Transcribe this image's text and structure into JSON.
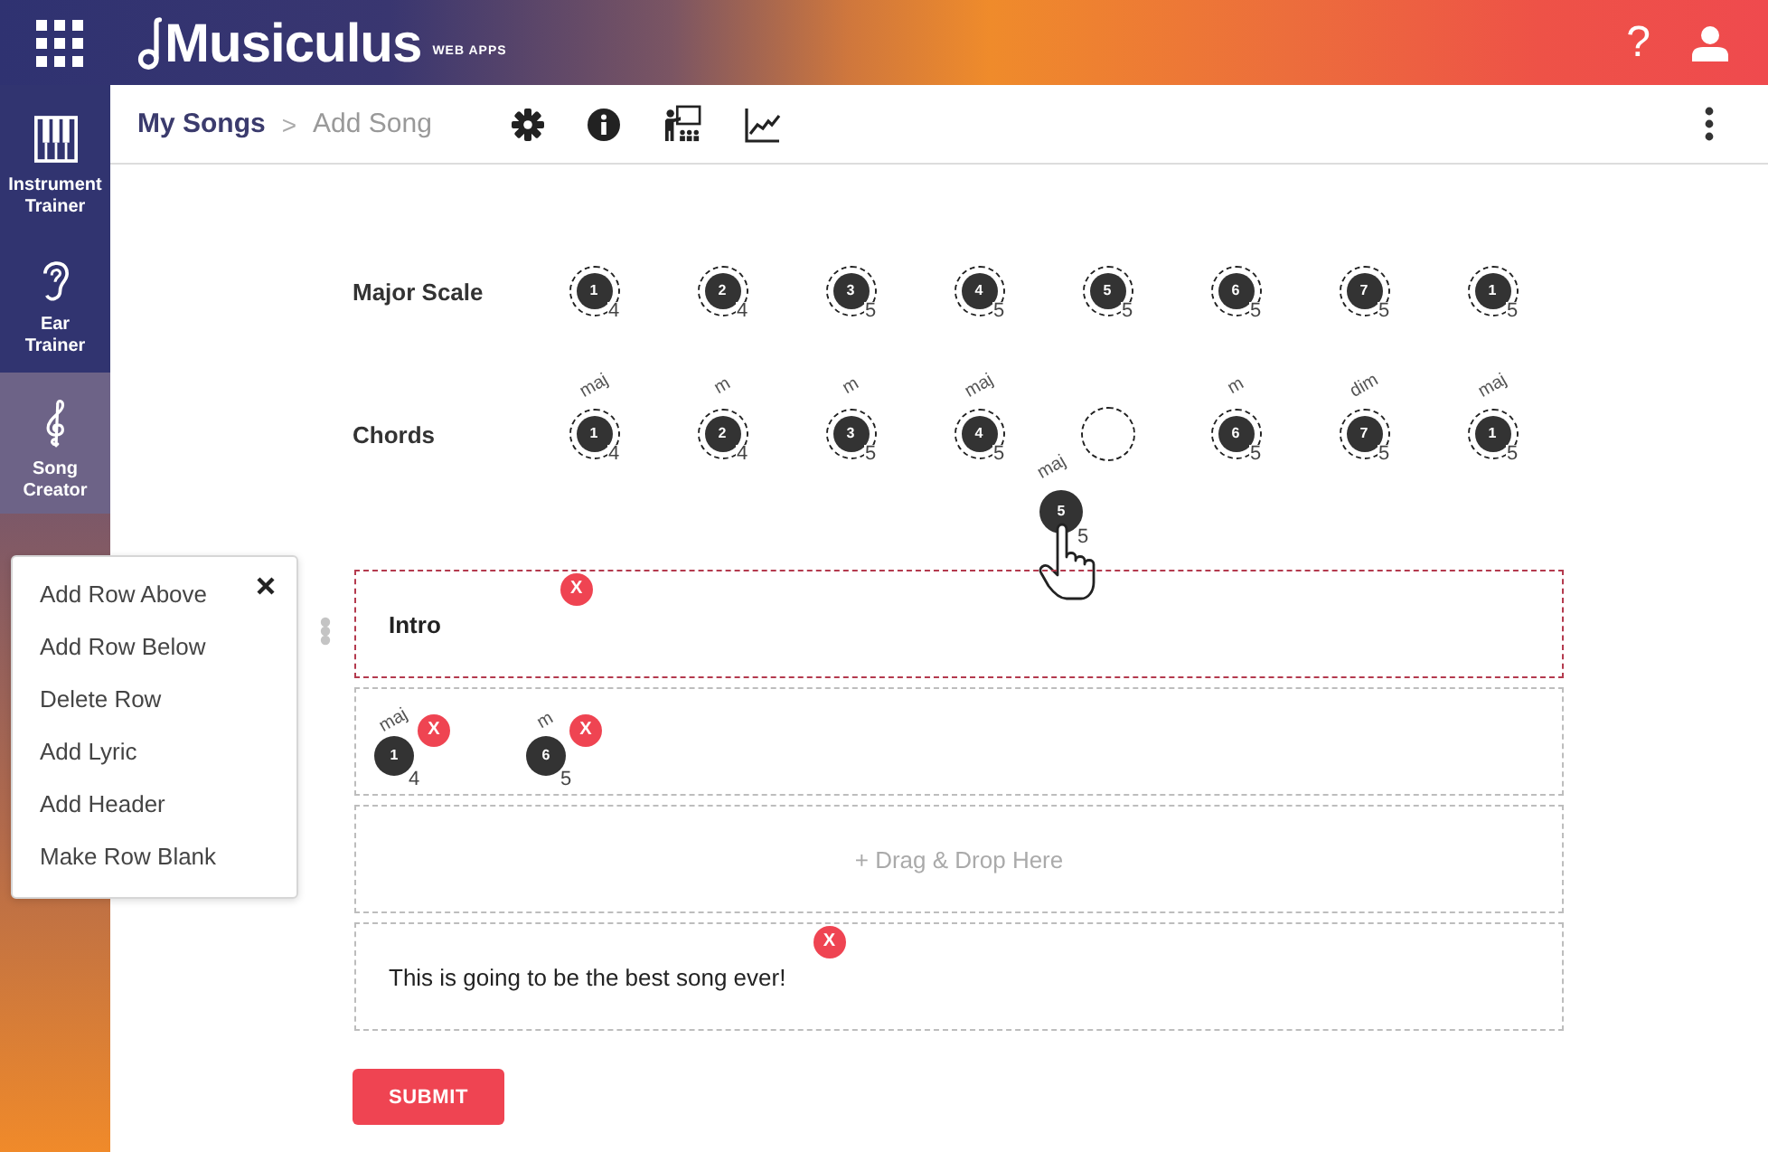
{
  "top_bar": {
    "brand": "Musiculus",
    "brand_tag": "WEB APPS",
    "help": "?"
  },
  "sidebar": {
    "items": [
      {
        "label": "Instrument Trainer",
        "selected": false
      },
      {
        "label": "Ear Trainer",
        "selected": false
      },
      {
        "label": "Song Creator",
        "selected": true
      }
    ]
  },
  "breadcrumb": {
    "items": [
      {
        "label": "My Songs",
        "selected": false
      },
      {
        "label": "Add Song",
        "selected": true
      }
    ],
    "separator": ">"
  },
  "scale": {
    "label": "Major Scale",
    "notes": [
      {
        "degree": "1",
        "octave": "4"
      },
      {
        "degree": "2",
        "octave": "4"
      },
      {
        "degree": "3",
        "octave": "5"
      },
      {
        "degree": "4",
        "octave": "5"
      },
      {
        "degree": "5",
        "octave": "5"
      },
      {
        "degree": "6",
        "octave": "5"
      },
      {
        "degree": "7",
        "octave": "5"
      },
      {
        "degree": "1",
        "octave": "5"
      }
    ]
  },
  "chords": {
    "label": "Chords",
    "slots": [
      {
        "kind": "chord",
        "degree": "1",
        "quality": "maj",
        "octave": "4"
      },
      {
        "kind": "chord",
        "degree": "2",
        "quality": "m",
        "octave": "4"
      },
      {
        "kind": "chord",
        "degree": "3",
        "quality": "m",
        "octave": "5"
      },
      {
        "kind": "chord",
        "degree": "4",
        "quality": "maj",
        "octave": "5"
      },
      {
        "kind": "empty"
      },
      {
        "kind": "chord",
        "degree": "6",
        "quality": "m",
        "octave": "5"
      },
      {
        "kind": "chord",
        "degree": "7",
        "quality": "dim",
        "octave": "5"
      },
      {
        "kind": "chord",
        "degree": "1",
        "quality": "maj",
        "octave": "5"
      }
    ]
  },
  "dragged_chord": {
    "degree": "5",
    "quality": "maj",
    "octave": "5"
  },
  "context_menu": {
    "items": [
      "Add Row Above",
      "Add Row Below",
      "Delete Row",
      "Add Lyric",
      "Add Header",
      "Make Row Blank"
    ]
  },
  "song_rows": [
    {
      "kind": "header",
      "selected": true,
      "text": "Intro",
      "delete": "X"
    },
    {
      "kind": "chords",
      "selected": false,
      "chords": [
        {
          "degree": "1",
          "quality": "maj",
          "octave": "4",
          "delete": "X"
        },
        {
          "degree": "6",
          "quality": "m",
          "octave": "5",
          "delete": "X"
        }
      ]
    },
    {
      "kind": "drop",
      "selected": false,
      "text": "+ Drag & Drop Here"
    },
    {
      "kind": "lyric",
      "selected": false,
      "text": "This is going to be the best song ever!",
      "delete": "X"
    }
  ],
  "submit": "SUBMIT"
}
